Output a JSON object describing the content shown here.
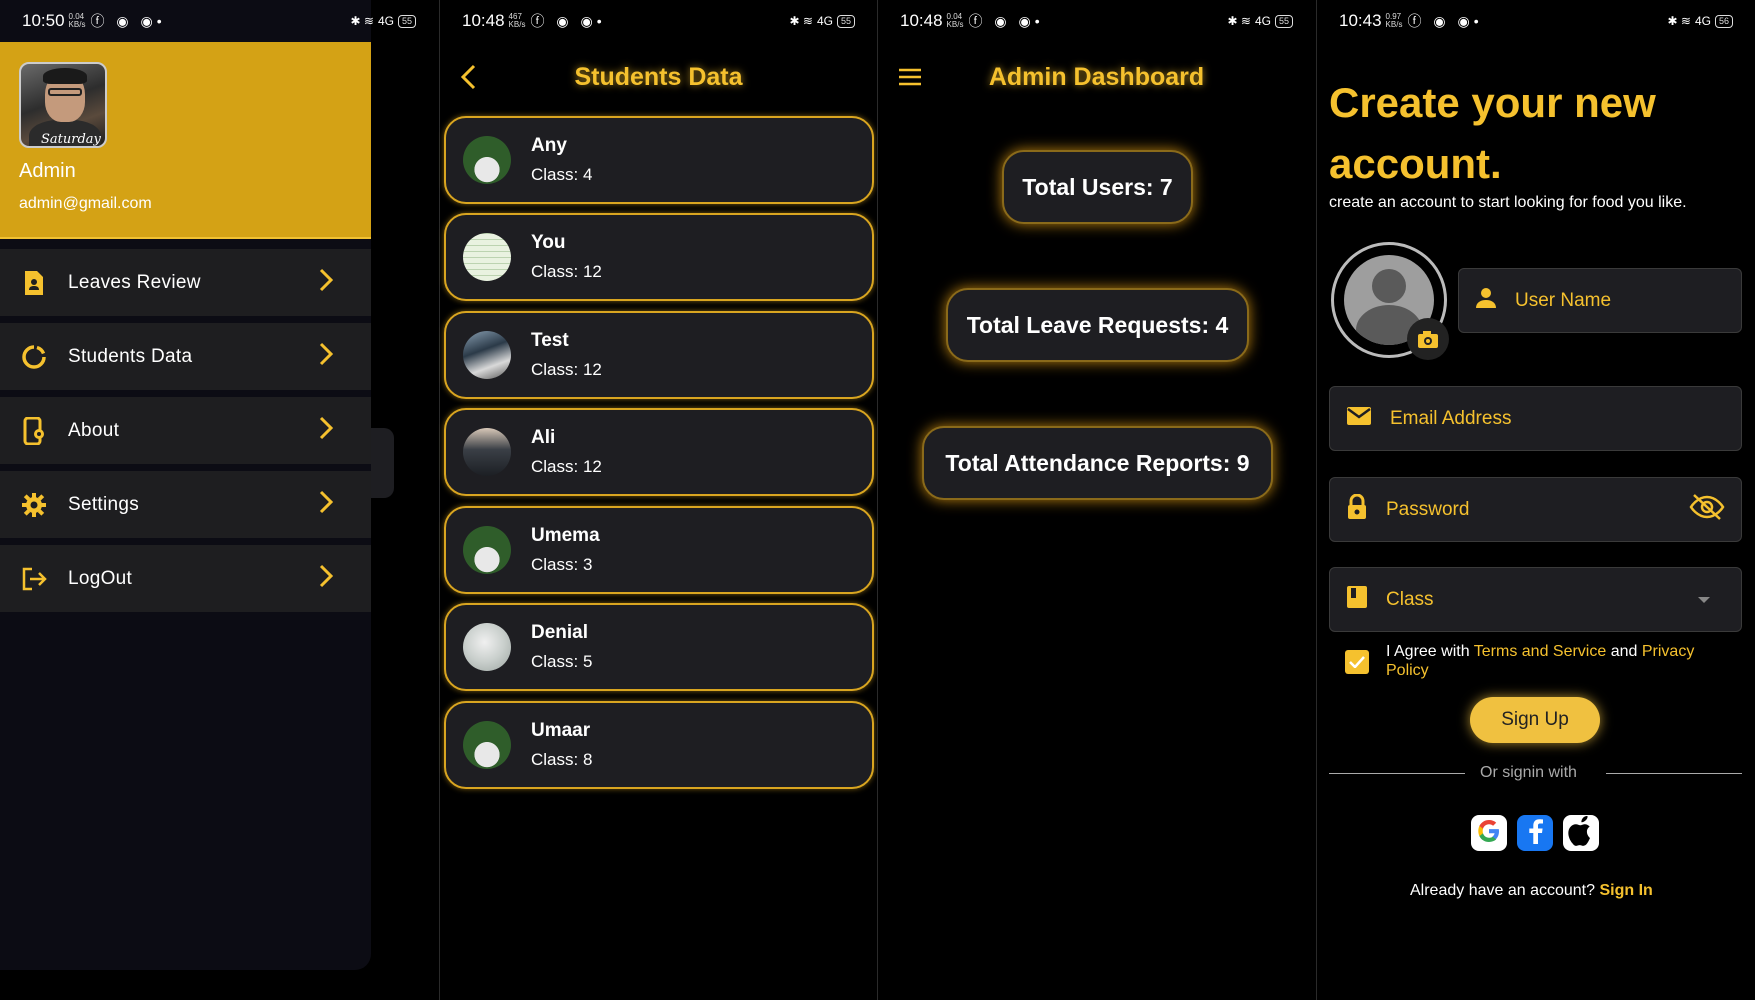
{
  "colors": {
    "accent": "#f5c12e",
    "header_gold": "#d4a215",
    "card": "#1e1e22",
    "background": "#000000"
  },
  "screen1": {
    "status": {
      "time": "10:50",
      "net": "0.04 KB/s",
      "signal": "4G",
      "battery": "55"
    },
    "profile": {
      "name": "Admin",
      "email": "admin@gmail.com",
      "avatar_caption": "Saturday"
    },
    "menu": [
      {
        "label": "Leaves Review",
        "icon": "document-person-icon"
      },
      {
        "label": "Students Data",
        "icon": "loading-circle-icon"
      },
      {
        "label": "About",
        "icon": "phone-settings-icon"
      },
      {
        "label": "Settings",
        "icon": "gear-icon"
      },
      {
        "label": "LogOut",
        "icon": "logout-icon"
      }
    ]
  },
  "screen2": {
    "status": {
      "time": "10:48",
      "net": "467 KB/s",
      "signal": "4G",
      "battery": "55"
    },
    "title": "Students Data",
    "students": [
      {
        "name": "Any",
        "class": "Class: 4"
      },
      {
        "name": "You",
        "class": "Class: 12"
      },
      {
        "name": "Test",
        "class": "Class: 12"
      },
      {
        "name": "Ali",
        "class": "Class: 12"
      },
      {
        "name": "Umema",
        "class": "Class: 3"
      },
      {
        "name": "Denial",
        "class": "Class: 5"
      },
      {
        "name": "Umaar",
        "class": "Class: 8"
      }
    ]
  },
  "screen3": {
    "status": {
      "time": "10:48",
      "net": "0.04 KB/s",
      "signal": "4G",
      "battery": "55"
    },
    "title": "Admin Dashboard",
    "stats": {
      "users": "Total Users: 7",
      "leaves": "Total Leave Requests: 4",
      "attendance": "Total Attendance Reports: 9"
    }
  },
  "screen4": {
    "status": {
      "time": "10:43",
      "net": "0.97 KB/s",
      "signal": "4G",
      "battery": "56"
    },
    "title": "Create your new account.",
    "subtitle": "create an account to start looking for food you like.",
    "fields": {
      "username": "User Name",
      "email": "Email Address",
      "password": "Password",
      "class": "Class"
    },
    "agree": {
      "prefix": "I Agree with ",
      "terms": "Terms and Service",
      "and": " and ",
      "privacy": "Privacy Policy"
    },
    "signup": "Sign Up",
    "or_signin": "Or signin with",
    "already": "Already have an account? ",
    "signin": "Sign In"
  }
}
